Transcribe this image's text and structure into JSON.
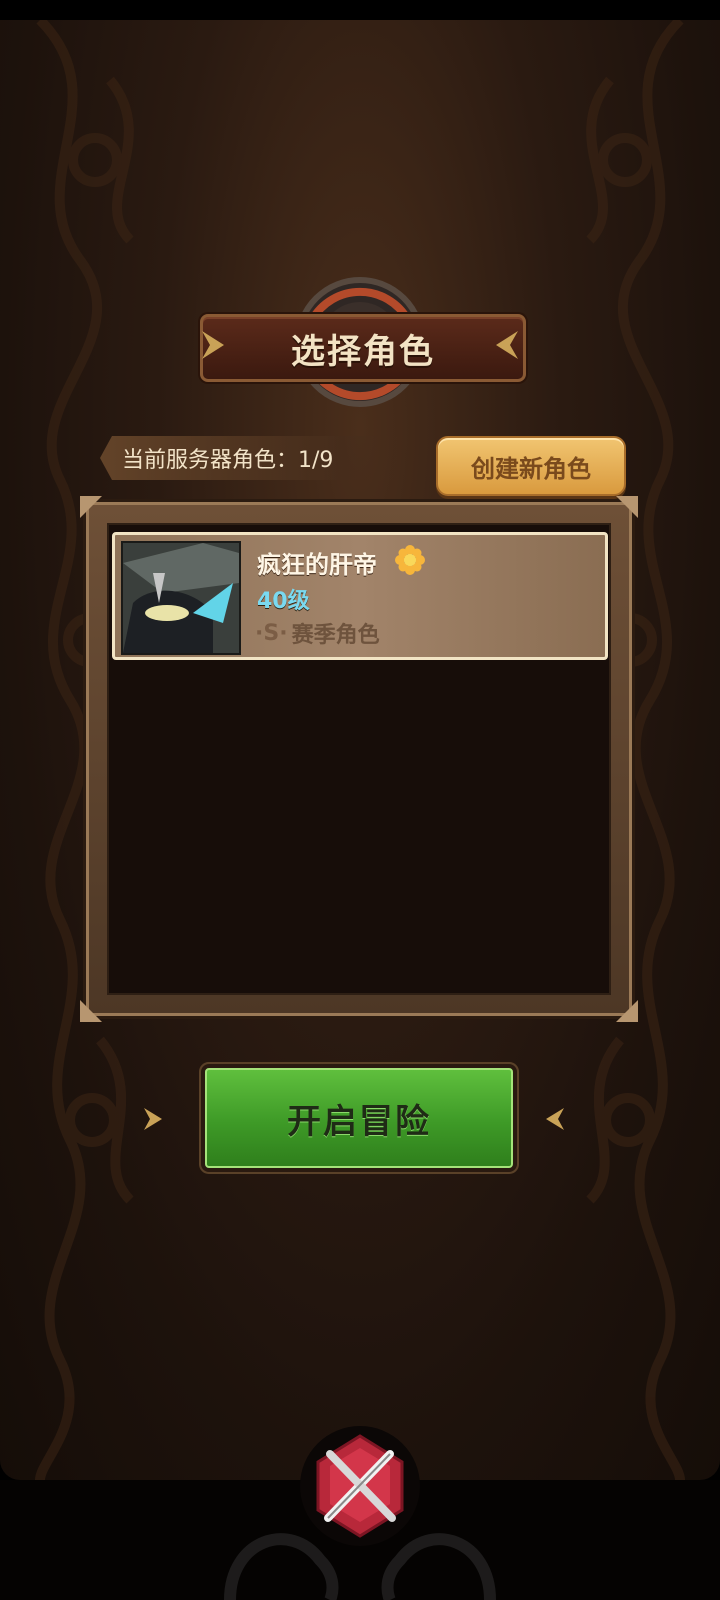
{
  "title": "选择角色",
  "server": {
    "label": "当前服务器角色：1/9"
  },
  "buttons": {
    "create": "创建新角色",
    "start": "开启冒险"
  },
  "characters": [
    {
      "name": "疯狂的肝帝",
      "level": "40级",
      "season_label": "赛季角色",
      "badge_icon": "flower-icon"
    }
  ],
  "colors": {
    "accent_green": "#3e9a27",
    "gold_button": "#e3a84f",
    "level_cyan": "#7ad9f0",
    "panel_brown": "#2a1a11"
  }
}
